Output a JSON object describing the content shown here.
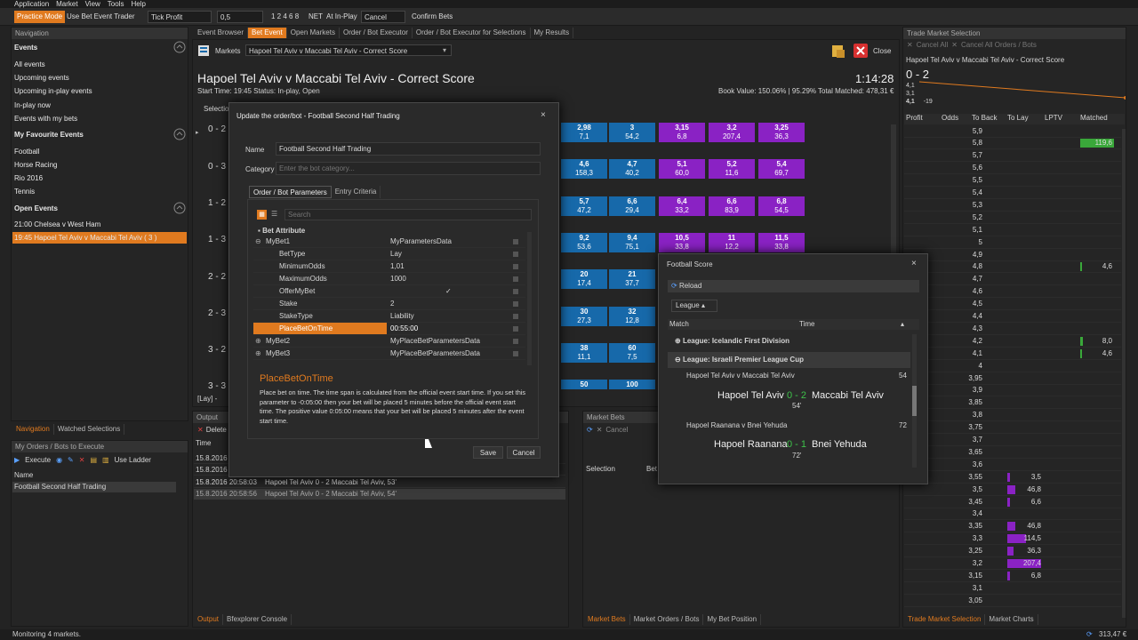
{
  "menu": [
    "Application",
    "Market",
    "View",
    "Tools",
    "Help"
  ],
  "toolbar": {
    "practice": "Practice Mode",
    "use_bet_event_trader": "Use Bet Event Trader",
    "tick_profit": "Tick Profit",
    "value": "0,5",
    "ticks": "1  2  4  6  8",
    "net": "NET",
    "at_in_play": "At In-Play",
    "cancel": "Cancel",
    "confirm_bets": "Confirm Bets"
  },
  "navigation": {
    "title": "Navigation",
    "events_header": "Events",
    "items": [
      "All events",
      "Upcoming events",
      "Upcoming in-play events",
      "In-play now",
      "Events with my bets"
    ],
    "favourites_header": "My Favourite Events",
    "favourites": [
      "Football",
      "Horse Racing",
      "Rio 2016",
      "Tennis"
    ],
    "open_header": "Open Events",
    "open": [
      "21:00 Chelsea v West Ham",
      "19:45 Hapoel Tel Aviv v Maccabi Tel Aviv ( 3 )"
    ],
    "bottom_tabs": [
      "Navigation",
      "Watched Selections"
    ]
  },
  "orders_panel": {
    "title": "My Orders / Bots to Execute",
    "execute": "Execute",
    "use_ladder": "Use Ladder",
    "col_name": "Name",
    "row": "Football Second Half Trading"
  },
  "main_tabs": [
    "Event Browser",
    "Bet Event",
    "Open Markets",
    "Order / Bot Executor",
    "Order / Bot Executor for Selections",
    "My Results"
  ],
  "market_bar": {
    "label": "Markets",
    "selected": "Hapoel Tel Aviv v Maccabi Tel Aviv - Correct Score",
    "close": "Close"
  },
  "market": {
    "title": "Hapoel Tel Aviv v Maccabi Tel Aviv - Correct Score",
    "time": "1:14:28",
    "info": "Start Time: 19:45 Status: In-play, Open",
    "book": "Book Value: 150.06% | 95.29%",
    "matched": "Total Matched: 478,31 €",
    "selection_header": "Selectio",
    "scores": [
      "0 - 2",
      "0 - 3",
      "1 - 2",
      "1 - 3",
      "2 - 2",
      "2 - 3",
      "3 - 2",
      "3 - 3"
    ],
    "lay_toggle": "[Lay] -"
  },
  "price_grid": [
    [
      [
        "2,98",
        "7,1"
      ],
      [
        "3",
        "54,2"
      ],
      [
        "3,15",
        "6,8"
      ],
      [
        "3,2",
        "207,4"
      ],
      [
        "3,25",
        "36,3"
      ]
    ],
    [
      [
        "4,6",
        "158,3"
      ],
      [
        "4,7",
        "40,2"
      ],
      [
        "5,1",
        "60,0"
      ],
      [
        "5,2",
        "11,6"
      ],
      [
        "5,4",
        "69,7"
      ]
    ],
    [
      [
        "5,7",
        "47,2"
      ],
      [
        "6,6",
        "29,4"
      ],
      [
        "6,4",
        "33,2"
      ],
      [
        "6,6",
        "83,9"
      ],
      [
        "6,8",
        "54,5"
      ]
    ],
    [
      [
        "9,2",
        "53,6"
      ],
      [
        "9,4",
        "75,1"
      ],
      [
        "10,5",
        "33,8"
      ],
      [
        "11",
        "12,2"
      ],
      [
        "11,5",
        "33,8"
      ]
    ],
    [
      [
        "20",
        "17,4"
      ],
      [
        "21",
        "37,7"
      ],
      [
        "",
        ""
      ],
      [
        "",
        ""
      ],
      [
        "",
        ""
      ]
    ],
    [
      [
        "30",
        "27,3"
      ],
      [
        "32",
        "12,8"
      ],
      [
        "",
        ""
      ],
      [
        "",
        ""
      ],
      [
        "",
        ""
      ]
    ],
    [
      [
        "38",
        "11,1"
      ],
      [
        "60",
        "7,5"
      ],
      [
        "",
        ""
      ],
      [
        "",
        ""
      ],
      [
        "",
        ""
      ]
    ],
    [
      [
        "50",
        ""
      ],
      [
        "100",
        ""
      ],
      [
        "",
        ""
      ],
      [
        "",
        ""
      ],
      [
        "",
        ""
      ]
    ]
  ],
  "output": {
    "title": "Output",
    "delete": "Delete",
    "col_time": "Time",
    "rows": [
      [
        "15.8.2016",
        ""
      ],
      [
        "15.8.2016",
        ""
      ],
      [
        "15.8.2016 20:58:03",
        "Hapoel Tel Aviv 0 - 2 Maccabi Tel Aviv, 53'"
      ],
      [
        "15.8.2016 20:58:56",
        "Hapoel Tel Aviv 0 - 2 Maccabi Tel Aviv, 54'"
      ]
    ],
    "tabs": [
      "Output",
      "Bfexplorer Console"
    ]
  },
  "market_bets": {
    "title": "Market Bets",
    "cancel": "Cancel",
    "col_selection": "Selection",
    "col_bet": "Bet",
    "tabs": [
      "Market Bets",
      "Market Orders / Bots",
      "My Bet Position"
    ]
  },
  "dialog": {
    "title": "Update the order/bot - Football Second Half Trading",
    "name_label": "Name",
    "name_value": "Football Second Half Trading",
    "category_label": "Category",
    "category_placeholder": "Enter the bot category...",
    "tabs": [
      "Order / Bot Parameters",
      "Entry Criteria"
    ],
    "search_placeholder": "Search",
    "section": "Bet Attribute",
    "rows": [
      [
        "MyBet1",
        "MyParametersData"
      ],
      [
        "BetType",
        "Lay"
      ],
      [
        "MinimumOdds",
        "1,01"
      ],
      [
        "MaximumOdds",
        "1000"
      ],
      [
        "OfferMyBet",
        "✓"
      ],
      [
        "Stake",
        "2"
      ],
      [
        "StakeType",
        "Liability"
      ],
      [
        "PlaceBetOnTime",
        "00:55:00"
      ],
      [
        "MyBet2",
        "MyPlaceBetParametersData"
      ],
      [
        "MyBet3",
        "MyPlaceBetParametersData"
      ]
    ],
    "desc_title": "PlaceBetOnTime",
    "desc": "Place bet on time. The time span is calculated from the official event start time. If you set this parameter to -0:05:00 then your bet will be placed 5 minutes before the official event start time. The positive value 0:05:00 means that your bet will be placed 5 minutes after the event start time.",
    "save": "Save",
    "cancel": "Cancel"
  },
  "football_score": {
    "title": "Football Score",
    "reload": "Reload",
    "league_btn": "League",
    "col_match": "Match",
    "col_time": "Time",
    "league1": "League: Icelandic First Division",
    "league2": "League: Israeli Premier League Cup",
    "matches": [
      {
        "name": "Hapoel Tel Aviv v Maccabi Tel Aviv",
        "time": "54",
        "home": "Hapoel Tel Aviv",
        "score": "0 - 2",
        "away": "Maccabi Tel Aviv",
        "minute": "54'"
      },
      {
        "name": "Hapoel Raanana v Bnei Yehuda",
        "time": "72",
        "home": "Hapoel Raanana",
        "score": "0 - 1",
        "away": "Bnei Yehuda",
        "minute": "72'"
      }
    ]
  },
  "trade": {
    "title": "Trade Market Selection",
    "cancel_all": "Cancel All",
    "cancel_all_orders": "Cancel All Orders / Bots",
    "market": "Hapoel Tel Aviv v Maccabi Tel Aviv - Correct Score",
    "selection": "0 - 2",
    "spark_labels": [
      "4,1",
      "3,1",
      "4,1",
      "-19"
    ],
    "cols": [
      "Profit",
      "Odds",
      "To Back",
      "To Lay",
      "LPTV",
      "Matched"
    ],
    "tabs": [
      "Trade Market Selection",
      "Market Charts"
    ],
    "ladder": [
      [
        "5,9",
        "",
        "",
        ""
      ],
      [
        "5,8",
        "",
        "",
        "119,6"
      ],
      [
        "5,7",
        "",
        "",
        ""
      ],
      [
        "5,6",
        "",
        "",
        ""
      ],
      [
        "5,5",
        "",
        "",
        ""
      ],
      [
        "5,4",
        "",
        "",
        ""
      ],
      [
        "5,3",
        "",
        "",
        ""
      ],
      [
        "5,2",
        "",
        "",
        ""
      ],
      [
        "5,1",
        "",
        "",
        ""
      ],
      [
        "5",
        "",
        "",
        ""
      ],
      [
        "4,9",
        "",
        "",
        ""
      ],
      [
        "4,8",
        "",
        "",
        "4,6"
      ],
      [
        "4,7",
        "",
        "",
        ""
      ],
      [
        "4,6",
        "",
        "",
        ""
      ],
      [
        "4,5",
        "",
        "",
        ""
      ],
      [
        "4,4",
        "",
        "",
        ""
      ],
      [
        "4,3",
        "",
        "",
        ""
      ],
      [
        "4,2",
        "",
        "",
        "8,0"
      ],
      [
        "4,1",
        "",
        "",
        "4,6"
      ],
      [
        "4",
        "",
        "",
        ""
      ],
      [
        "3,95",
        "",
        "",
        ""
      ],
      [
        "3,9",
        "",
        "",
        ""
      ],
      [
        "3,85",
        "",
        "",
        ""
      ],
      [
        "3,8",
        "",
        "",
        ""
      ],
      [
        "3,75",
        "",
        "",
        ""
      ],
      [
        "3,7",
        "",
        "",
        ""
      ],
      [
        "3,65",
        "",
        "",
        ""
      ],
      [
        "3,6",
        "",
        "",
        ""
      ],
      [
        "3,55",
        "",
        "3,5",
        ""
      ],
      [
        "3,5",
        "",
        "46,8",
        ""
      ],
      [
        "3,45",
        "",
        "6,6",
        ""
      ],
      [
        "3,4",
        "",
        "",
        ""
      ],
      [
        "3,35",
        "",
        "46,8",
        ""
      ],
      [
        "3,3",
        "",
        "114,5",
        ""
      ],
      [
        "3,25",
        "",
        "36,3",
        ""
      ],
      [
        "3,2",
        "",
        "207,4",
        ""
      ],
      [
        "3,15",
        "",
        "6,8",
        ""
      ],
      [
        "3,1",
        "",
        "",
        ""
      ],
      [
        "3,05",
        "",
        "",
        ""
      ]
    ]
  },
  "status": {
    "text": "Monitoring 4 markets.",
    "balance": "313,47 €"
  }
}
